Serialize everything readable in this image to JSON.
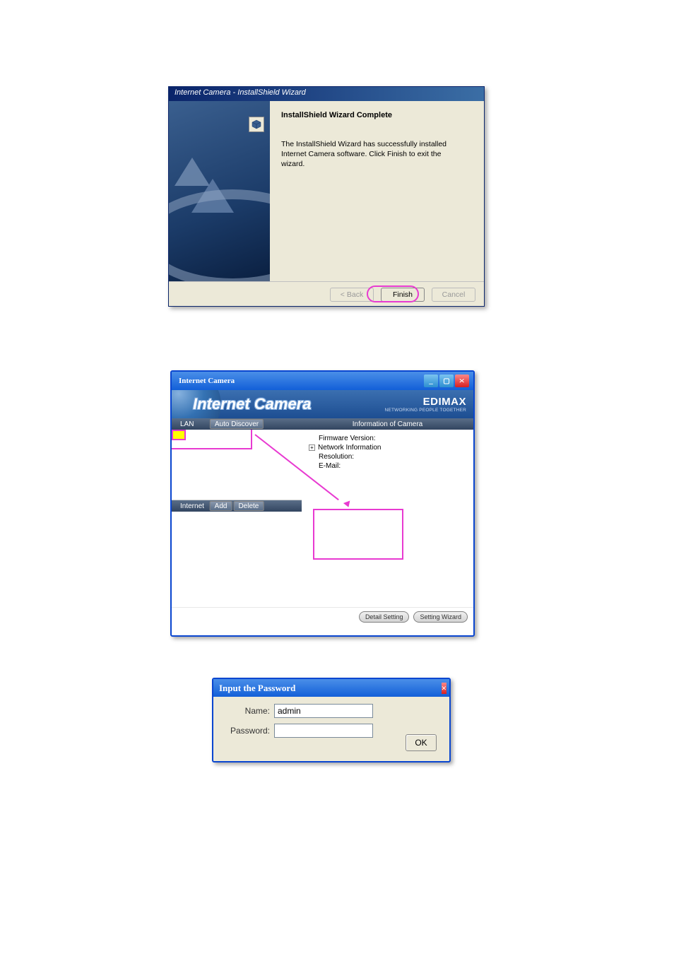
{
  "installshield": {
    "title": "Internet Camera - InstallShield Wizard",
    "heading": "InstallShield Wizard Complete",
    "text": "The InstallShield Wizard has successfully installed Internet Camera software. Click Finish to exit the wizard.",
    "back": "< Back",
    "finish": "Finish",
    "cancel": "Cancel"
  },
  "iccam": {
    "window_title": "Internet Camera",
    "banner_title": "Internet Camera",
    "brand": "EDIMAX",
    "brand_tag": "NETWORKING PEOPLE TOGETHER",
    "lan_label": "LAN",
    "auto_discover": "Auto Discover",
    "internet_label": "Internet",
    "add": "Add",
    "delete": "Delete",
    "info_header": "Information of Camera",
    "info_items": {
      "firmware": "Firmware Version:",
      "network": "Network Information",
      "resolution": "Resolution:",
      "email": "E-Mail:"
    },
    "detail_setting": "Detail Setting",
    "setting_wizard": "Setting Wizard"
  },
  "pwd": {
    "title": "Input the Password",
    "name_label": "Name:",
    "name_value": "admin",
    "password_label": "Password:",
    "password_value": "",
    "ok": "OK"
  }
}
